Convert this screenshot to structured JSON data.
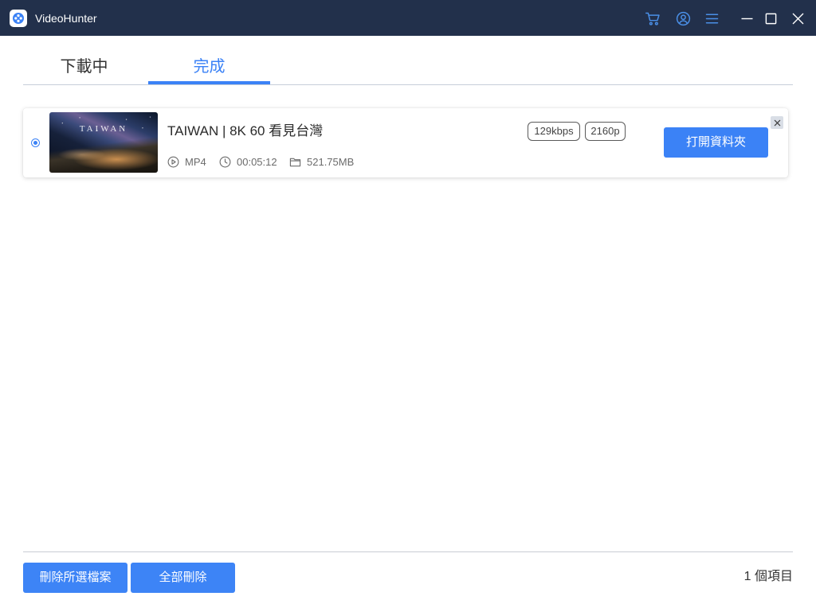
{
  "colors": {
    "titlebar_bg": "#22304b",
    "accent": "#3b82f6",
    "titlebar_icon": "#4a8fe7",
    "text": "#2b2b2b"
  },
  "window": {
    "title": "VideoHunter",
    "logo_icon": "app-logo",
    "controls": [
      "cart-icon",
      "user-icon",
      "menu-icon",
      "minimize-icon",
      "maximize-icon",
      "close-icon"
    ]
  },
  "tabs": [
    {
      "label": "下載中",
      "active": false
    },
    {
      "label": "完成",
      "active": true
    }
  ],
  "items": [
    {
      "selected": true,
      "thumbnail_text": "TAIWAN",
      "title": "TAIWAN | 8K 60 看見台灣",
      "format_icon": "play-circle-icon",
      "format": "MP4",
      "duration_icon": "clock-icon",
      "duration": "00:05:12",
      "size_icon": "folder-icon",
      "size": "521.75MB",
      "bitrate": "129kbps",
      "resolution": "2160p",
      "open_folder_label": "打開資料夾",
      "remove_icon": "close-icon"
    }
  ],
  "footer": {
    "delete_selected_label": "刪除所選檔案",
    "delete_all_label": "全部刪除",
    "count_label": "1 個項目"
  }
}
